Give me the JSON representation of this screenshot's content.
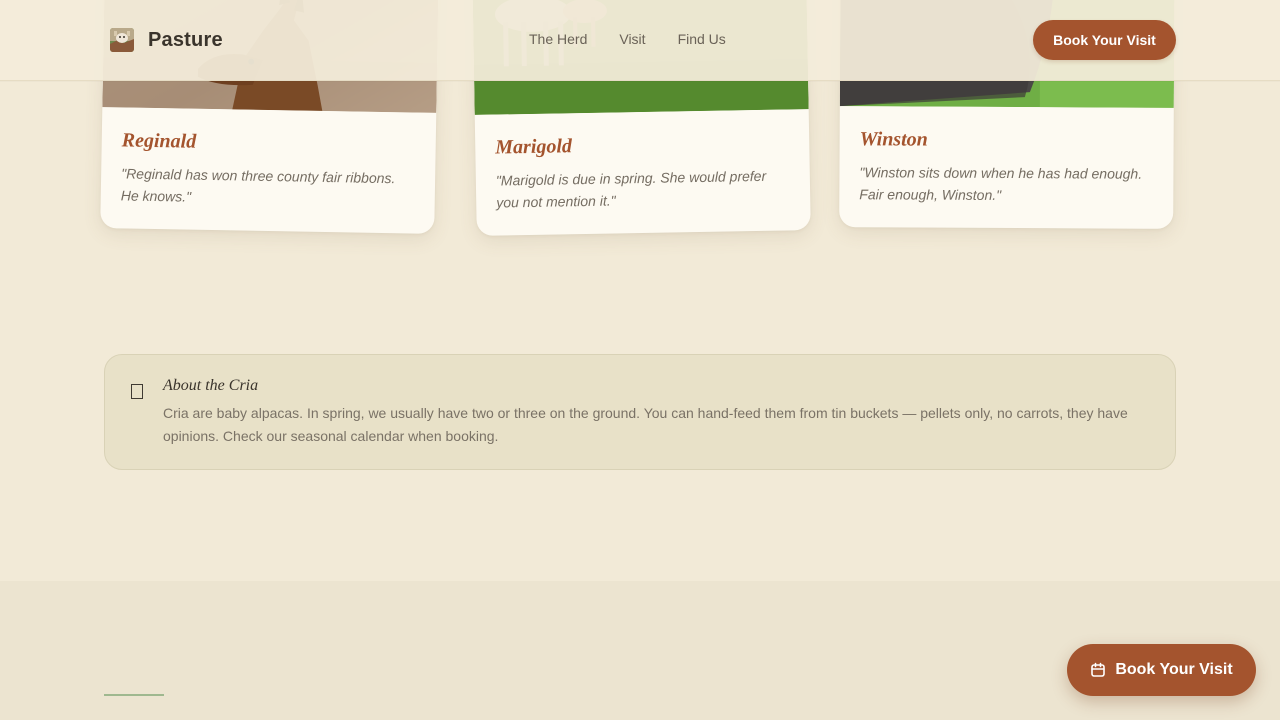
{
  "header": {
    "brand_name": "Pasture",
    "nav": [
      "The Herd",
      "Visit",
      "Find Us"
    ],
    "cta_label": "Book Your Visit"
  },
  "herd": [
    {
      "name": "Reginald",
      "quote": "\"Reginald has won three county fair ribbons. He knows.\""
    },
    {
      "name": "Marigold",
      "quote": "\"Marigold is due in spring. She would prefer you not mention it.\""
    },
    {
      "name": "Winston",
      "quote": "\"Winston sits down when he has had enough. Fair enough, Winston.\""
    }
  ],
  "cria": {
    "icon": "book-icon",
    "title": "About the Cria",
    "text": "Cria are baby alpacas. In spring, we usually have two or three on the ground. You can hand-feed them from tin buckets — pellets only, no carrots, they have opinions. Check our seasonal calendar when booking."
  },
  "fab": {
    "label": "Book Your Visit",
    "icon": "calendar-icon"
  },
  "colors": {
    "accent": "#a4542e",
    "background": "#f2ead7",
    "card": "#fdfaf2",
    "info_box": "#e8e1c8",
    "footer_rule": "#9fb88f"
  }
}
